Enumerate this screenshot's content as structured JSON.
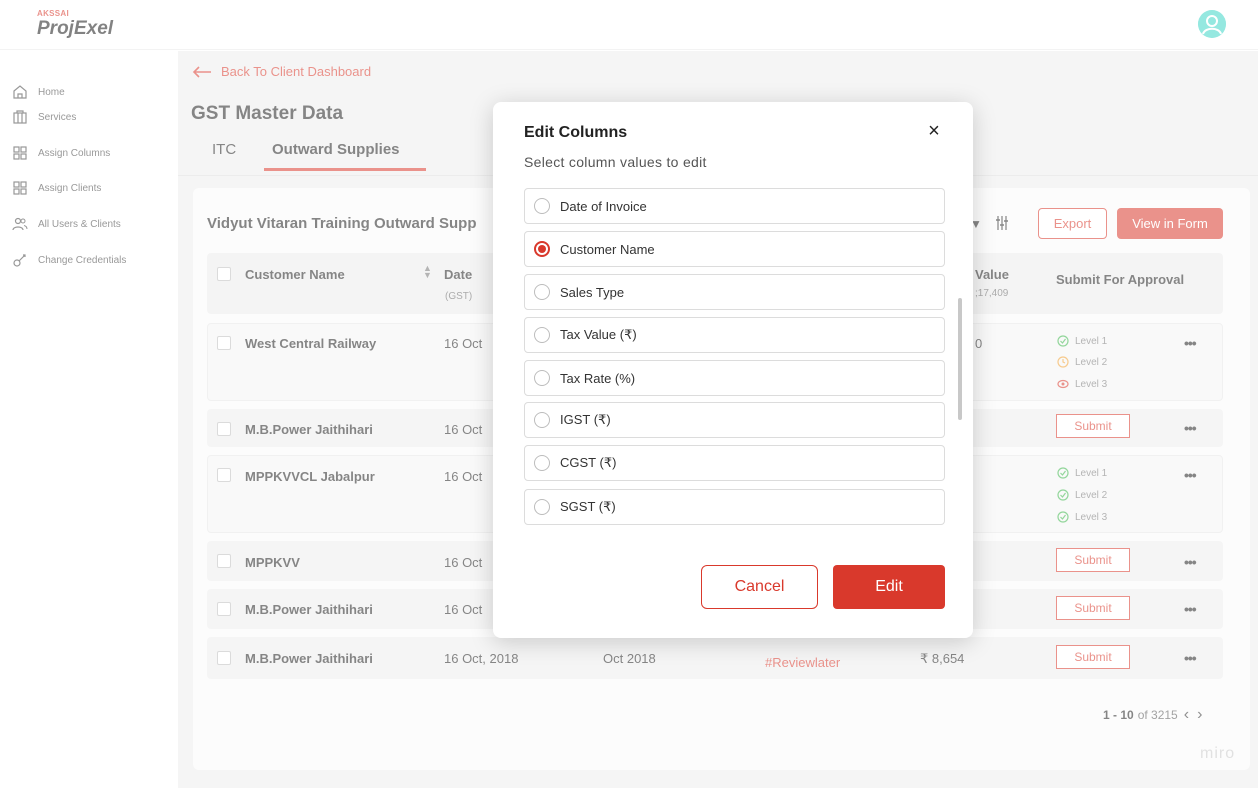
{
  "brand": {
    "small": "AKSSAI",
    "main": "ProjExel"
  },
  "sidebar": {
    "items": [
      {
        "label": "Home",
        "icon": "home-icon"
      },
      {
        "label": "Services",
        "icon": "services-icon"
      },
      {
        "label": "Assign Columns",
        "icon": "grid-icon"
      },
      {
        "label": "Assign Clients",
        "icon": "grid-icon"
      },
      {
        "label": "All Users & Clients",
        "icon": "users-icon"
      },
      {
        "label": "Change Credentials",
        "icon": "key-icon"
      }
    ]
  },
  "header": {
    "back_label": "Back To Client Dashboard",
    "title": "GST Master Data",
    "tabs": [
      {
        "label": "ITC",
        "active": false
      },
      {
        "label": "Outward Supplies",
        "active": true
      }
    ]
  },
  "table": {
    "title": "Vidyut Vitaran Training Outward Supp",
    "export_label": "Export",
    "view_form_label": "View in Form",
    "columns": {
      "customer_name": "Customer Name",
      "date": "Date",
      "date_sub": "(GST)",
      "value": "Value",
      "value_sub": ";17,409",
      "submit": "Submit For Approval"
    },
    "rows": [
      {
        "customer": "West Central Railway",
        "date": "16 Oct",
        "value": "0"
      },
      {
        "customer": "M.B.Power Jaithihari",
        "date": "16 Oct",
        "submit": "Submit"
      },
      {
        "customer": "MPPKVVCL Jabalpur",
        "date": "16 Oct"
      },
      {
        "customer": "MPPKVV",
        "date": "16 Oct",
        "submit": "Submit"
      },
      {
        "customer": "M.B.Power Jaithihari",
        "date": "16 Oct",
        "submit": "Submit"
      },
      {
        "customer": "M.B.Power Jaithihari",
        "date": "16 Oct, 2018",
        "period": "Oct 2018",
        "tag": "#Reviewlater",
        "value": "₹ 8,654",
        "submit": "Submit"
      }
    ],
    "levels_row1": [
      "Level 1",
      "Level 2",
      "Level 3"
    ],
    "levels_row3": [
      "Level 1",
      "Level 2",
      "Level 3"
    ],
    "more": "•••"
  },
  "pagination": {
    "range": "1 - 10",
    "of_label": "of 3215",
    "prev": "‹",
    "next": "›"
  },
  "watermark": "miro",
  "modal": {
    "title": "Edit Columns",
    "subtitle": "Select column values to edit",
    "close": "×",
    "options": [
      {
        "label": "Date of Invoice",
        "checked": false
      },
      {
        "label": "Customer Name",
        "checked": true
      },
      {
        "label": "Sales Type",
        "checked": false
      },
      {
        "label": "Tax Value (₹)",
        "checked": false
      },
      {
        "label": "Tax Rate (%)",
        "checked": false
      },
      {
        "label": "IGST (₹)",
        "checked": false
      },
      {
        "label": "CGST (₹)",
        "checked": false
      },
      {
        "label": "SGST (₹)",
        "checked": false
      }
    ],
    "cancel_label": "Cancel",
    "edit_label": "Edit"
  },
  "colors": {
    "accent": "#d9392c",
    "avatar": "#3fd6c7",
    "level_ok": "#3bb54a",
    "level_pending": "#f0a032"
  }
}
